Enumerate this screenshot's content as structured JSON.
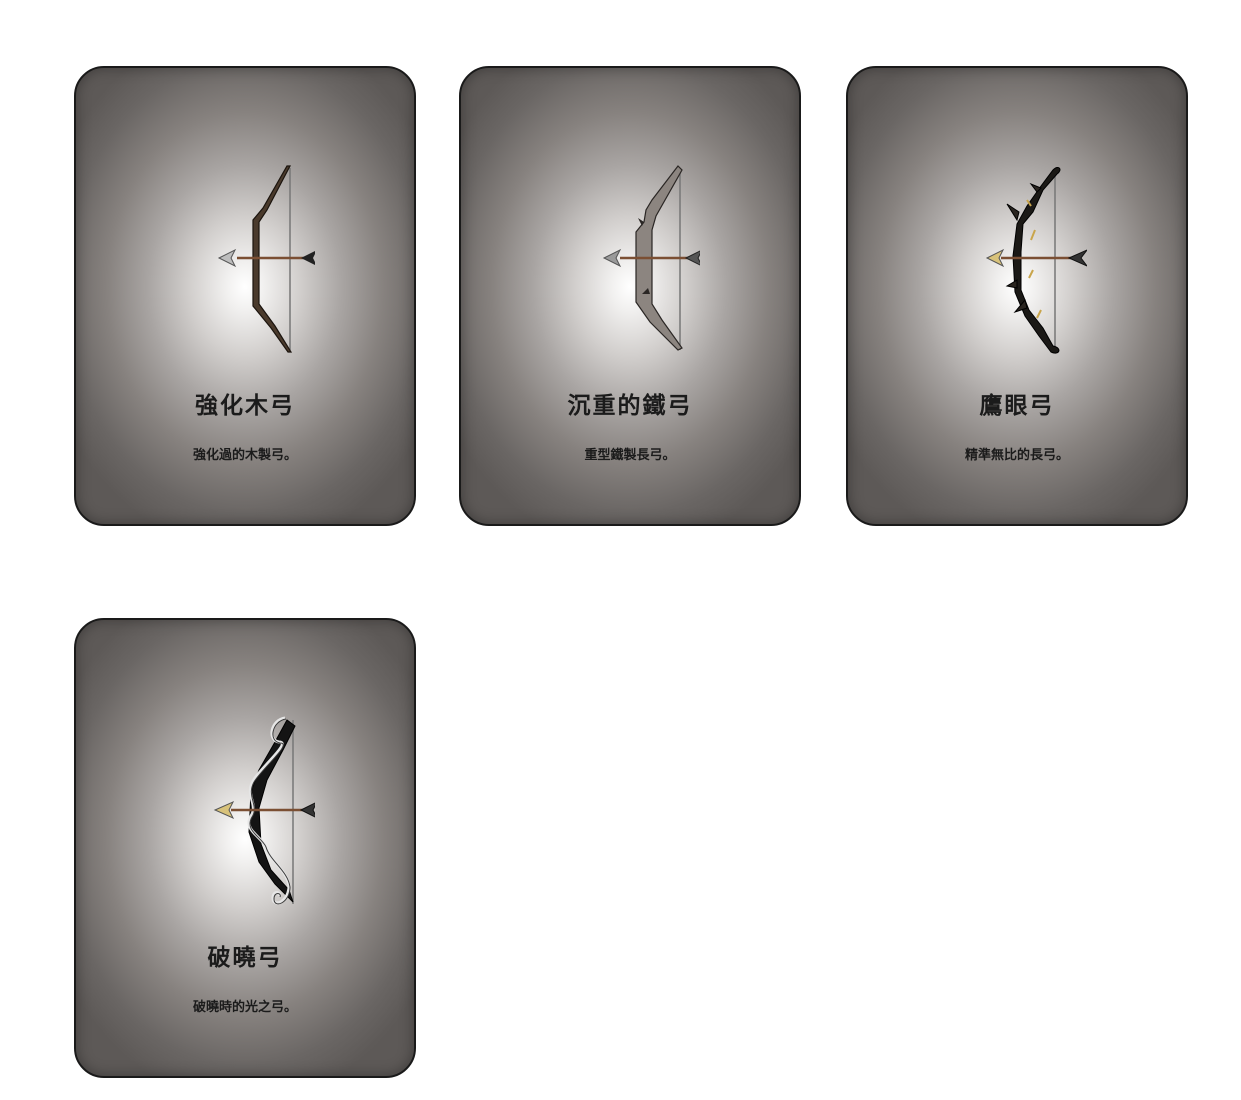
{
  "cards": [
    {
      "name": "強化木弓",
      "desc": "強化過的木製弓。",
      "icon": "wooden-bow-icon"
    },
    {
      "name": "沉重的鐵弓",
      "desc": "重型鐵製長弓。",
      "icon": "iron-bow-icon"
    },
    {
      "name": "鷹眼弓",
      "desc": "精準無比的長弓。",
      "icon": "hawkeye-bow-icon"
    },
    {
      "name": "破曉弓",
      "desc": "破曉時的光之弓。",
      "icon": "dawn-bow-icon"
    }
  ]
}
